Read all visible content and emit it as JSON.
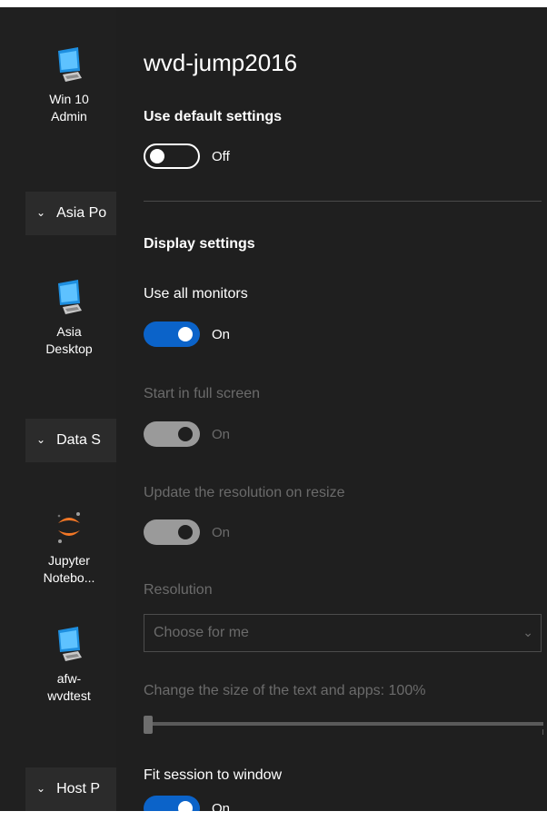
{
  "left_list": {
    "apps": [
      {
        "label_line1": "Win 10",
        "label_line2": "Admin",
        "icon": "monitor-icon"
      },
      {
        "label_line1": "Asia",
        "label_line2": "Desktop",
        "icon": "monitor-icon"
      },
      {
        "label_line1": "Jupyter",
        "label_line2": "Notebo...",
        "icon": "jupyter-icon"
      },
      {
        "label_line1": "afw-",
        "label_line2": "wvdtest",
        "icon": "monitor-icon"
      }
    ],
    "groups": [
      {
        "label": "Asia Po"
      },
      {
        "label": "Data S"
      },
      {
        "label": "Host P"
      }
    ]
  },
  "panel": {
    "title": "wvd-jump2016",
    "default_settings": {
      "heading": "Use default settings",
      "state": "Off"
    },
    "display_heading": "Display settings",
    "use_all_monitors": {
      "label": "Use all monitors",
      "state": "On"
    },
    "full_screen": {
      "label": "Start in full screen",
      "state": "On"
    },
    "update_resolution": {
      "label": "Update the resolution on resize",
      "state": "On"
    },
    "resolution": {
      "label": "Resolution",
      "value": "Choose for me"
    },
    "text_size": {
      "label": "Change the size of the text and apps: 100%",
      "value": 100
    },
    "fit_session": {
      "label": "Fit session to window",
      "state": "On"
    }
  },
  "colors": {
    "panel_bg": "#1f1f1f",
    "list_bg": "#202020",
    "accent": "#0b63c9",
    "disabled_text": "#6b6b6b"
  }
}
